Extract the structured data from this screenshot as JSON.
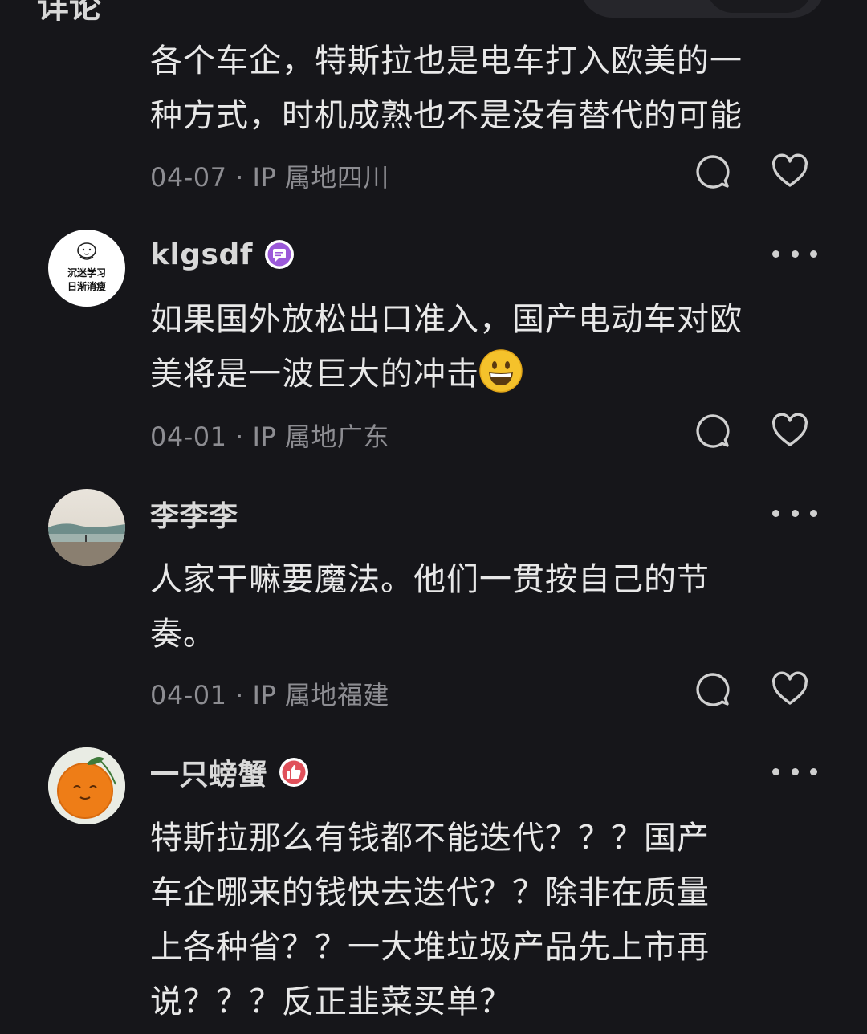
{
  "header": {
    "title_fragment": "详论"
  },
  "comments": [
    {
      "body": "各个车企，特斯拉也是电车打入欧美的一\n种方式，时机成熟也不是没有替代的可能",
      "date": "04-07",
      "ip_location": "IP 属地四川",
      "meta_separator": " · "
    },
    {
      "username": "klgsdf",
      "avatar_text_line1": "沉迷学习",
      "avatar_text_line2": "日渐消瘦",
      "badge_icon": "chat-bubble-badge-icon",
      "badge_color": "#9b59d9",
      "body": "如果国外放松出口准入，国产电动车对欧\n美将是一波巨大的冲击",
      "emoji": "grinning-face-emoji",
      "date": "04-01",
      "ip_location": "IP 属地广东",
      "meta_separator": " · "
    },
    {
      "username": "李李李",
      "body": "人家干嘛要魔法。他们一贯按自己的节\n奏。",
      "date": "04-01",
      "ip_location": "IP 属地福建",
      "meta_separator": " · "
    },
    {
      "username": "一只螃蟹",
      "badge_icon": "thumbs-up-badge-icon",
      "badge_color": "#e0505a",
      "body": "特斯拉那么有钱都不能迭代？？？国产\n车企哪来的钱快去迭代？？除非在质量\n上各种省？？一大堆垃圾产品先上市再\n说？？？反正韭菜买单？"
    }
  ],
  "icons": {
    "reply": "reply-bubble-icon",
    "like": "heart-icon",
    "more": "more-dots-icon"
  },
  "colors": {
    "background": "#16161a",
    "text_primary": "#e8e8e8",
    "text_secondary": "#8d8d92"
  }
}
